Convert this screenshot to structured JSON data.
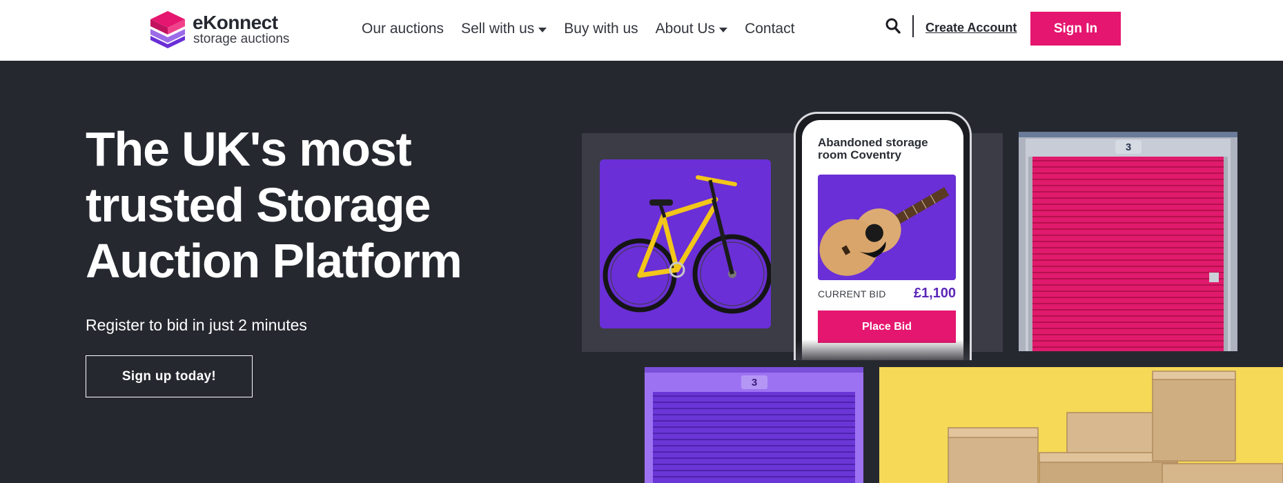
{
  "brand": {
    "name": "eKonnect",
    "tagline": "storage auctions",
    "colors": {
      "pink": "#e5166f",
      "purple": "#6a2fd6",
      "dark": "#262830",
      "yellow": "#f5d957"
    }
  },
  "nav": {
    "items": [
      {
        "label": "Our auctions",
        "has_dropdown": false
      },
      {
        "label": "Sell with us",
        "has_dropdown": true
      },
      {
        "label": "Buy with us",
        "has_dropdown": false
      },
      {
        "label": "About Us",
        "has_dropdown": true
      },
      {
        "label": "Contact",
        "has_dropdown": false
      }
    ],
    "search_icon": "search-icon",
    "create_account": "Create Account",
    "sign_in": "Sign In"
  },
  "hero": {
    "title_lines": [
      "The UK's most",
      "trusted Storage",
      "Auction Platform"
    ],
    "subtitle": "Register to bid in just 2 minutes",
    "cta": "Sign up today!"
  },
  "showcase": {
    "listing_title": "Abandoned storage room Coventry",
    "current_bid_label": "CURRENT BID",
    "current_bid_value": "£1,100",
    "place_bid": "Place Bid",
    "unit_number_pink": "3",
    "unit_number_purple": "3"
  }
}
